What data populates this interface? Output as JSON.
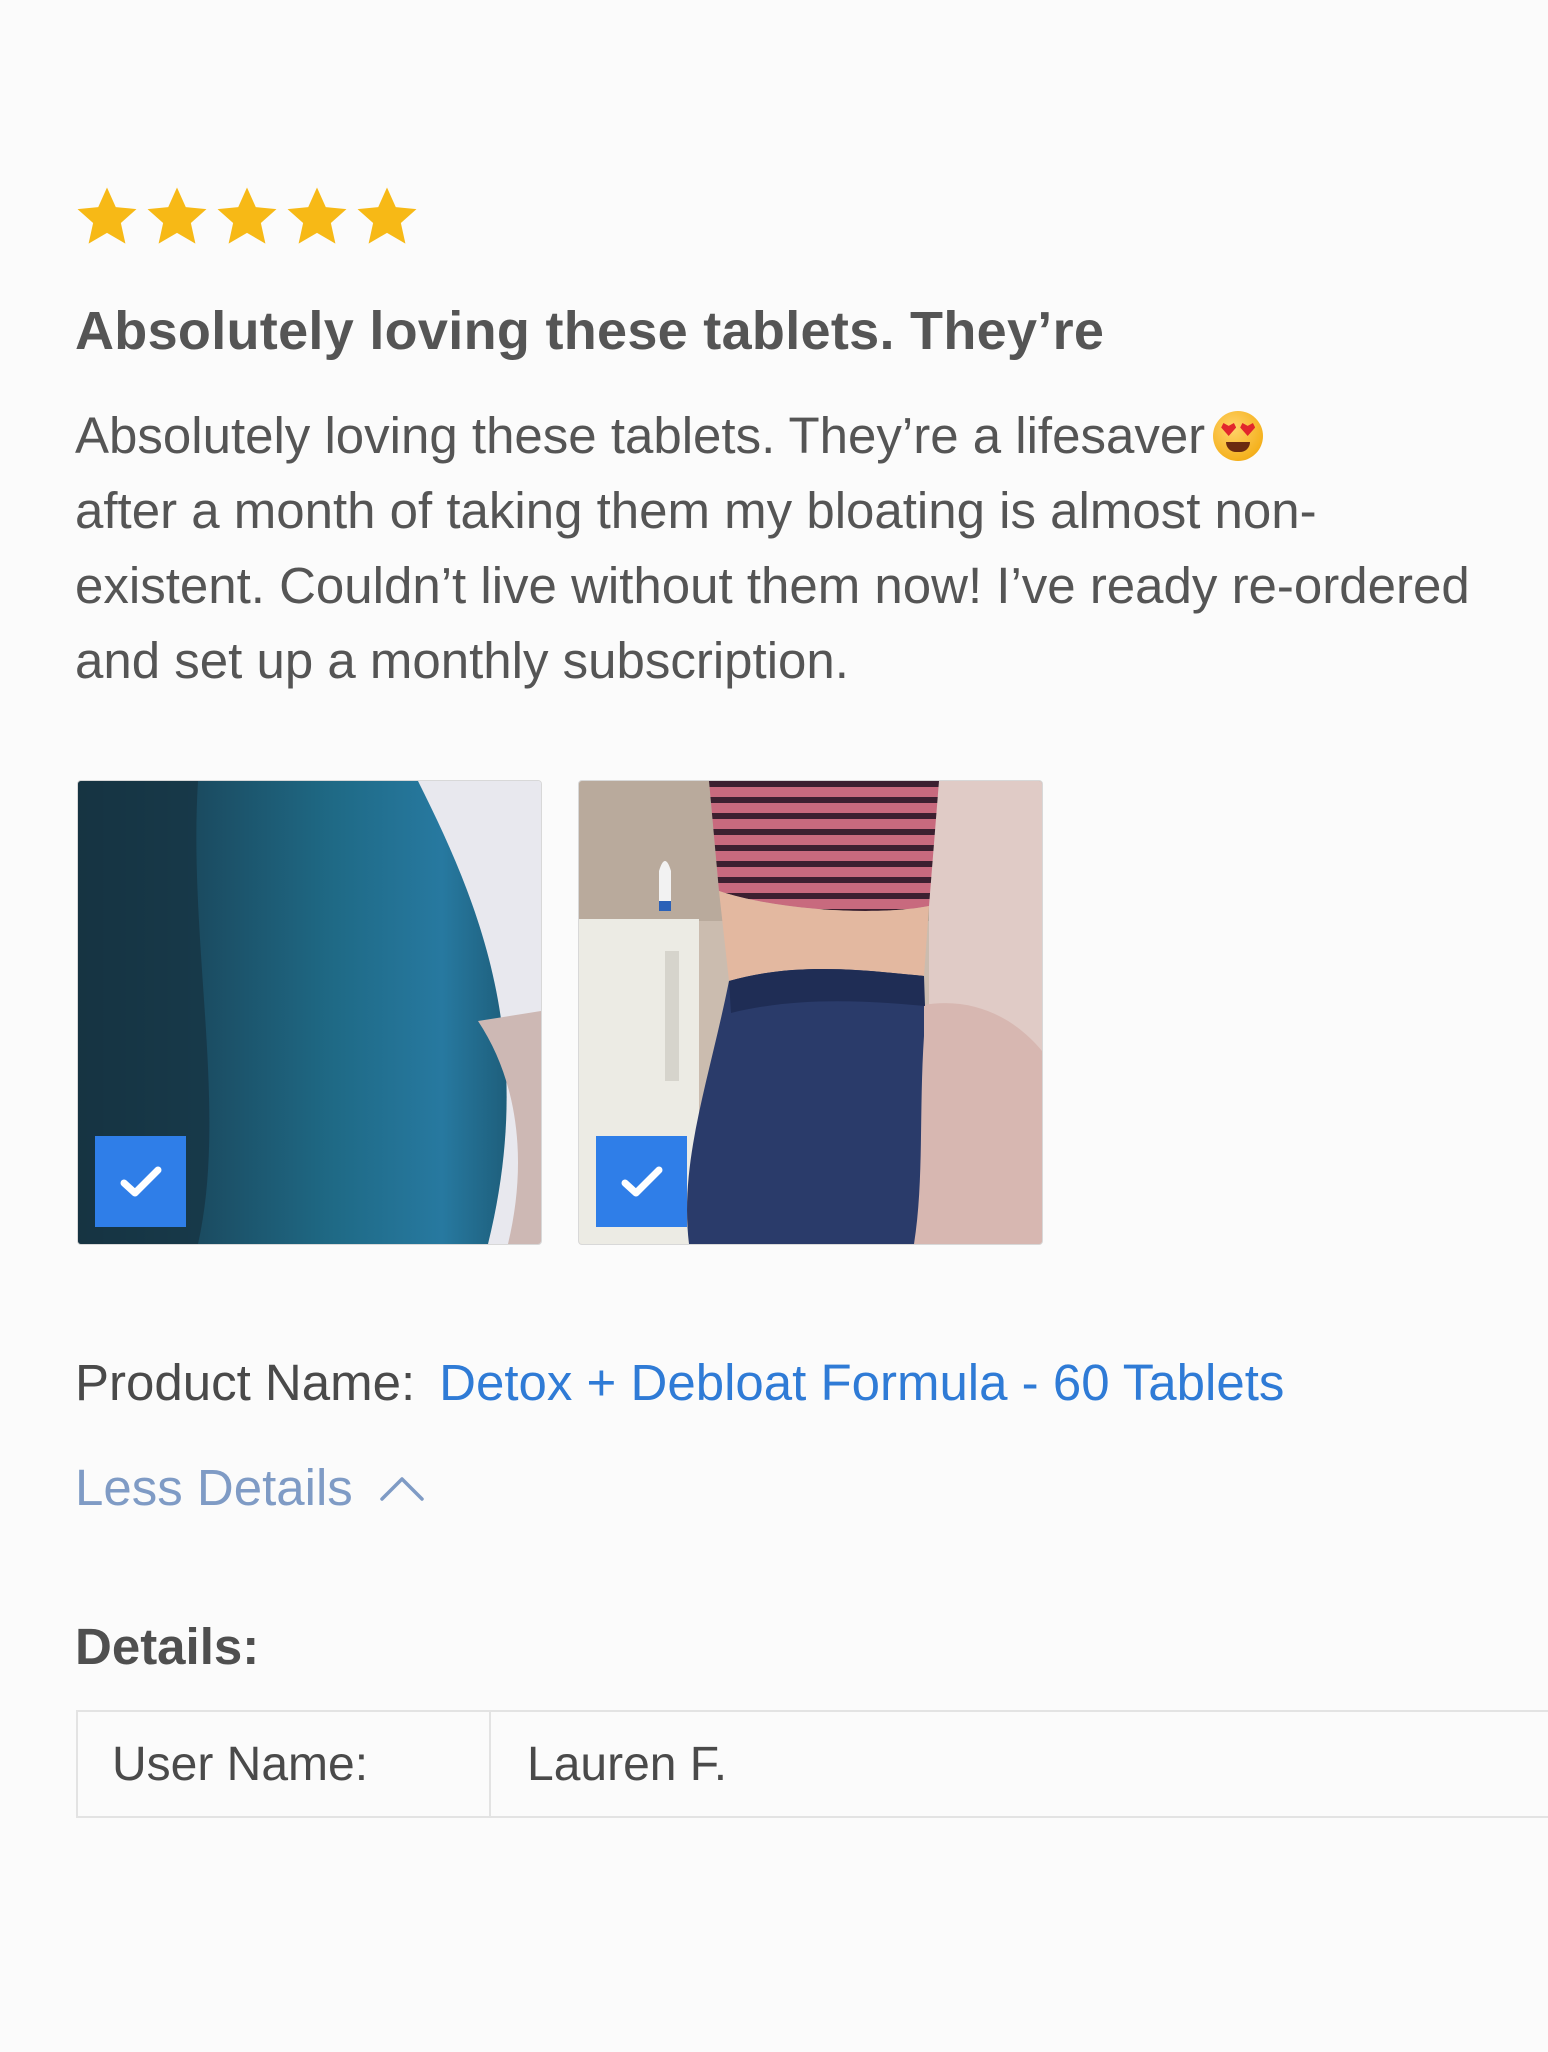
{
  "review": {
    "rating": 5,
    "rating_max": 5,
    "star_color": "#f7b916",
    "title": "Absolutely loving these tablets. They’re",
    "body": "Absolutely loving these tablets. They’re a lifesaver",
    "body_emoji": "smiling-face-with-heart-eyes",
    "body_rest": "after a month of taking them my bloating is almost non-existent. Couldn’t live without them now! I’ve ready re-ordered and set up a monthly subscription."
  },
  "photos": [
    {
      "checked": true
    },
    {
      "checked": true
    }
  ],
  "product": {
    "label": "Product Name:",
    "name": "Detox + Debloat Formula - 60 Tablets",
    "link_color": "#2f7bd6"
  },
  "toggle": {
    "label": "Less Details",
    "icon": "chevron-up-icon"
  },
  "details": {
    "heading": "Details:",
    "rows": [
      {
        "key": "User Name:",
        "value": "Lauren F."
      }
    ]
  },
  "colors": {
    "checkbox": "#2f7ee8"
  }
}
